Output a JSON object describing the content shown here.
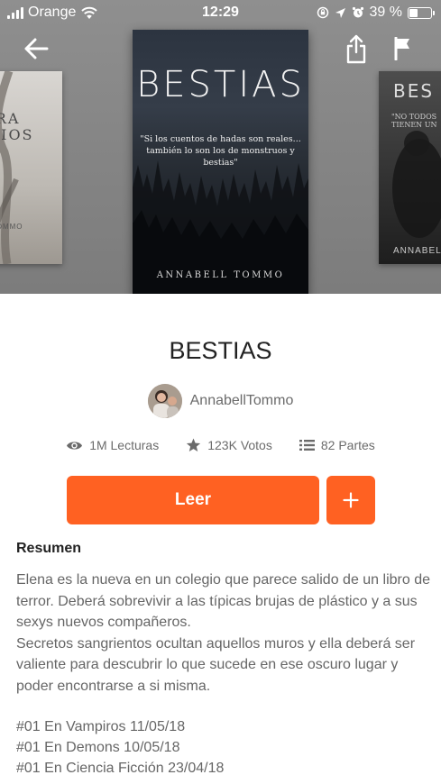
{
  "status_bar": {
    "carrier": "Orange",
    "time": "12:29",
    "battery": "39 %",
    "battery_level": 0.39,
    "icons": [
      "signal-icon",
      "wifi-icon",
      "orientation-lock-icon",
      "location-icon",
      "alarm-icon",
      "battery-icon"
    ]
  },
  "nav": {
    "back_icon": "arrow-left-icon",
    "share_icon": "share-icon",
    "report_icon": "flag-icon"
  },
  "cover": {
    "title": "BESTIAS",
    "quote": "\"Si los cuentos de hadas son reales... también lo son los de monstruos y bestias\"",
    "author": "ANNABELL TOMMO"
  },
  "side_covers": {
    "left": {
      "title": "PARA\nONIOS",
      "author": "TOMMO"
    },
    "right": {
      "title": "BES",
      "quote": "\"NO TODOS\nTIENEN UN",
      "author": "ANNABEL"
    }
  },
  "book": {
    "title": "BESTIAS",
    "author": "AnnabellTommo"
  },
  "stats": {
    "reads": "1M Lecturas",
    "votes": "123K Votos",
    "parts": "82 Partes"
  },
  "actions": {
    "read_label": "Leer",
    "add_label": "+"
  },
  "summary": {
    "heading": "Resumen",
    "paragraphs": [
      "Elena es la nueva en un colegio que parece salido de un libro de terror. Deberá sobrevivir a las típicas brujas de plástico y a sus sexys nuevos compañeros.",
      "Secretos sangrientos ocultan aquellos muros y ella deberá ser valiente para descubrir lo que sucede en ese oscuro lugar y poder encontrarse a si misma."
    ],
    "tags": [
      "#01 En Vampiros 11/05/18",
      "#01 En Demons 10/05/18",
      "#01 En Ciencia Ficción 23/04/18"
    ]
  },
  "colors": {
    "accent": "#ff6122",
    "text_primary": "#222222",
    "text_secondary": "#6b6b6b"
  }
}
